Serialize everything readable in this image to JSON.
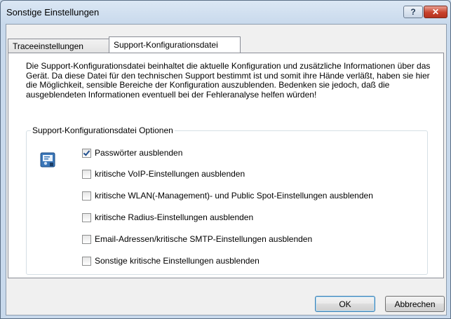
{
  "window": {
    "title": "Sonstige Einstellungen",
    "help_label": "?",
    "close_label": "✕"
  },
  "tabs": [
    {
      "label": "Traceeinstellungen"
    },
    {
      "label": "Support-Konfigurationsdatei"
    }
  ],
  "description": "Die Support-Konfigurationsdatei beinhaltet die aktuelle Konfiguration und zusätzliche Informationen über das Gerät. Da diese Datei für den technischen Support bestimmt ist und somit ihre Hände verläßt, haben sie hier die Möglichkeit, sensible Bereiche der Konfiguration auszublenden. Bedenken sie jedoch, daß die ausgeblendeten Informationen eventuell bei der Fehleranalyse helfen würden!",
  "group": {
    "title": "Support-Konfigurationsdatei Optionen",
    "icon": "config-file-icon",
    "options": [
      {
        "label": "Passwörter ausblenden",
        "checked": true
      },
      {
        "label": "kritische VoIP-Einstellungen ausblenden",
        "checked": false
      },
      {
        "label": "kritische WLAN(-Management)- und Public Spot-Einstellungen ausblenden",
        "checked": false
      },
      {
        "label": "kritische Radius-Einstellungen ausblenden",
        "checked": false
      },
      {
        "label": "Email-Adressen/kritische SMTP-Einstellungen ausblenden",
        "checked": false
      },
      {
        "label": "Sonstige kritische Einstellungen ausblenden",
        "checked": false
      }
    ]
  },
  "buttons": {
    "ok": "OK",
    "cancel": "Abbrechen"
  }
}
